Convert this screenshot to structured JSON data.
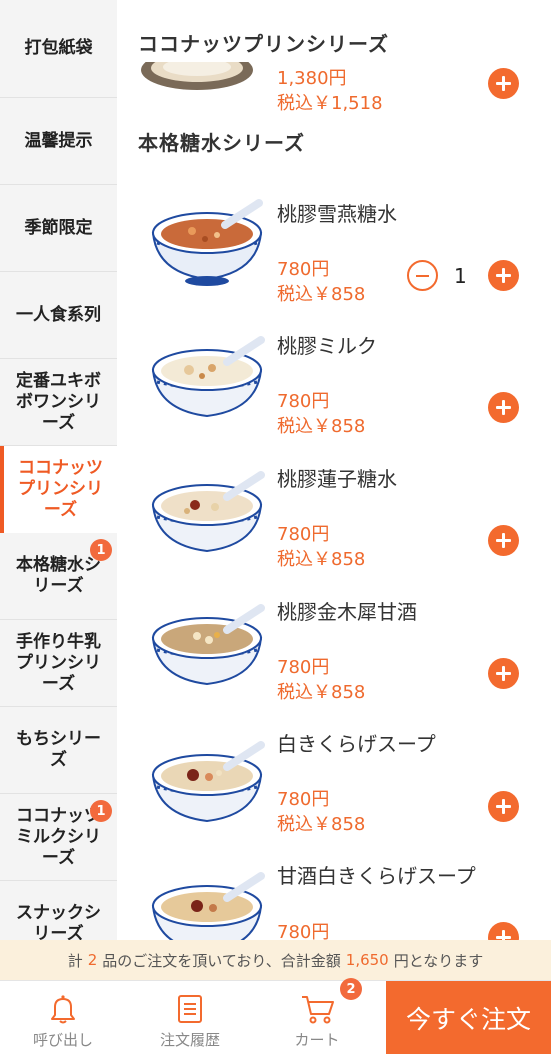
{
  "sidebar": {
    "items": [
      {
        "label": "打包紙袋"
      },
      {
        "label": "温馨提示"
      },
      {
        "label": "季節限定"
      },
      {
        "label": "一人食系列"
      },
      {
        "label": "定番ユキボボワンシリーズ"
      },
      {
        "label": "ココナッツプリンシリーズ",
        "active": true
      },
      {
        "label": "本格糖水シリーズ",
        "badge": "1"
      },
      {
        "label": "手作り牛乳プリンシリーズ"
      },
      {
        "label": "もちシリーズ"
      },
      {
        "label": "ココナッツミルクシリーズ",
        "badge": "1"
      },
      {
        "label": "スナックシリーズ"
      }
    ]
  },
  "main": {
    "sticky_section": "ココナッツプリンシリーズ",
    "partial_item": {
      "price": "1,380円",
      "price_tax": "税込￥1,518"
    },
    "section": "本格糖水シリーズ",
    "items": [
      {
        "name": "桃膠雪燕糖水",
        "price": "780円",
        "price_tax": "税込￥858",
        "qty": "1"
      },
      {
        "name": "桃膠ミルク",
        "price": "780円",
        "price_tax": "税込￥858"
      },
      {
        "name": "桃膠蓮子糖水",
        "price": "780円",
        "price_tax": "税込￥858"
      },
      {
        "name": "桃膠金木犀甘酒",
        "price": "780円",
        "price_tax": "税込￥858"
      },
      {
        "name": "白きくらげスープ",
        "price": "780円",
        "price_tax": "税込￥858"
      },
      {
        "name": "甘酒白きくらげスープ",
        "price": "780円"
      }
    ]
  },
  "notice": {
    "prefix": "計",
    "count": "2",
    "middle": "品のご注文を頂いており、合計金額",
    "amount": "1,650",
    "suffix": "円となります"
  },
  "bottom": {
    "tabs": [
      {
        "label": "呼び出し",
        "icon": "bell-icon"
      },
      {
        "label": "注文履歴",
        "icon": "order-history-icon"
      },
      {
        "label": "カート",
        "icon": "cart-icon",
        "badge": "2"
      }
    ],
    "order_button": "今すぐ注文"
  },
  "colors": {
    "accent": "#f36a2e",
    "notice_bg": "#fbf0dc",
    "sidebar_bg": "#f4f4f4"
  }
}
